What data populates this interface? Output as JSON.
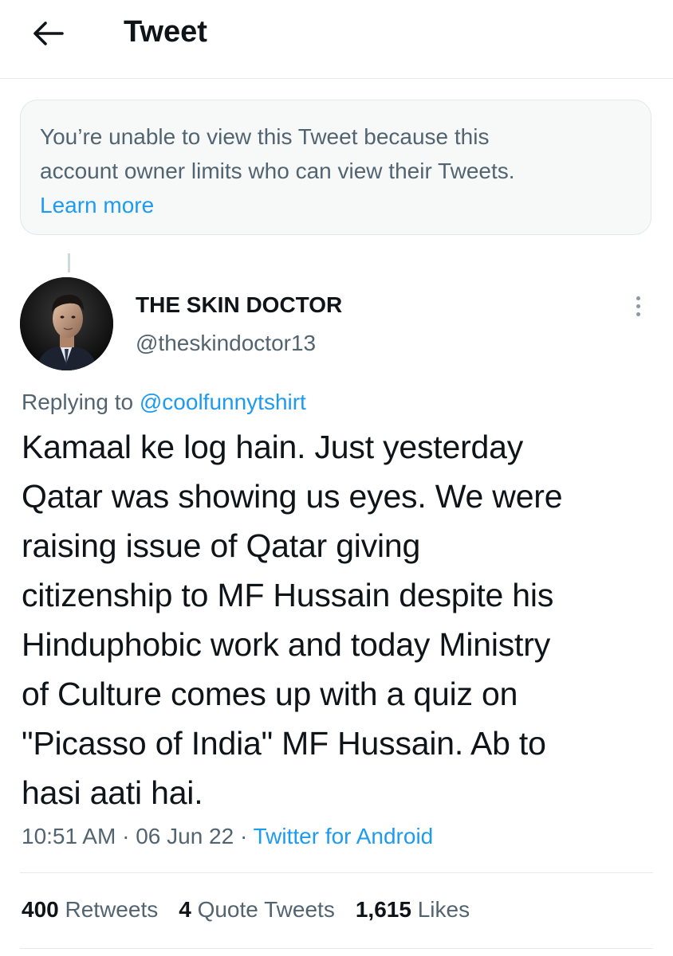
{
  "header": {
    "back_icon": "arrow-left-icon",
    "title": "Tweet"
  },
  "notice": {
    "line1": "You’re unable to view this Tweet because this",
    "line2": "account owner limits who can view their Tweets.",
    "learn_more": "Learn more",
    "link_color": "#1d9bf0"
  },
  "tweet": {
    "author_name": "THE SKIN DOCTOR",
    "author_handle": "@theskindoctor13",
    "more_icon": "more-vertical-icon",
    "replying_prefix": "Replying to",
    "replying_handle": "@coolfunnytshirt",
    "text": "Kamaal ke log hain. Just yesterday\nQatar was showing us eyes. We were\nraising issue of Qatar giving\ncitizenship to MF Hussain despite his\nHinduphobic work and today Ministry\nof Culture comes up with a quiz on\n\"Picasso of India\" MF Hussain. Ab to\nhasi aati hai.",
    "time": "10:51 AM",
    "date": "06 Jun 22",
    "separator": "·",
    "source": "Twitter for Android"
  },
  "stats": {
    "retweets_count": "400",
    "retweets_label": "Retweets",
    "quotes_count": "4",
    "quotes_label": "Quote Tweets",
    "likes_count": "1,615",
    "likes_label": "Likes"
  }
}
